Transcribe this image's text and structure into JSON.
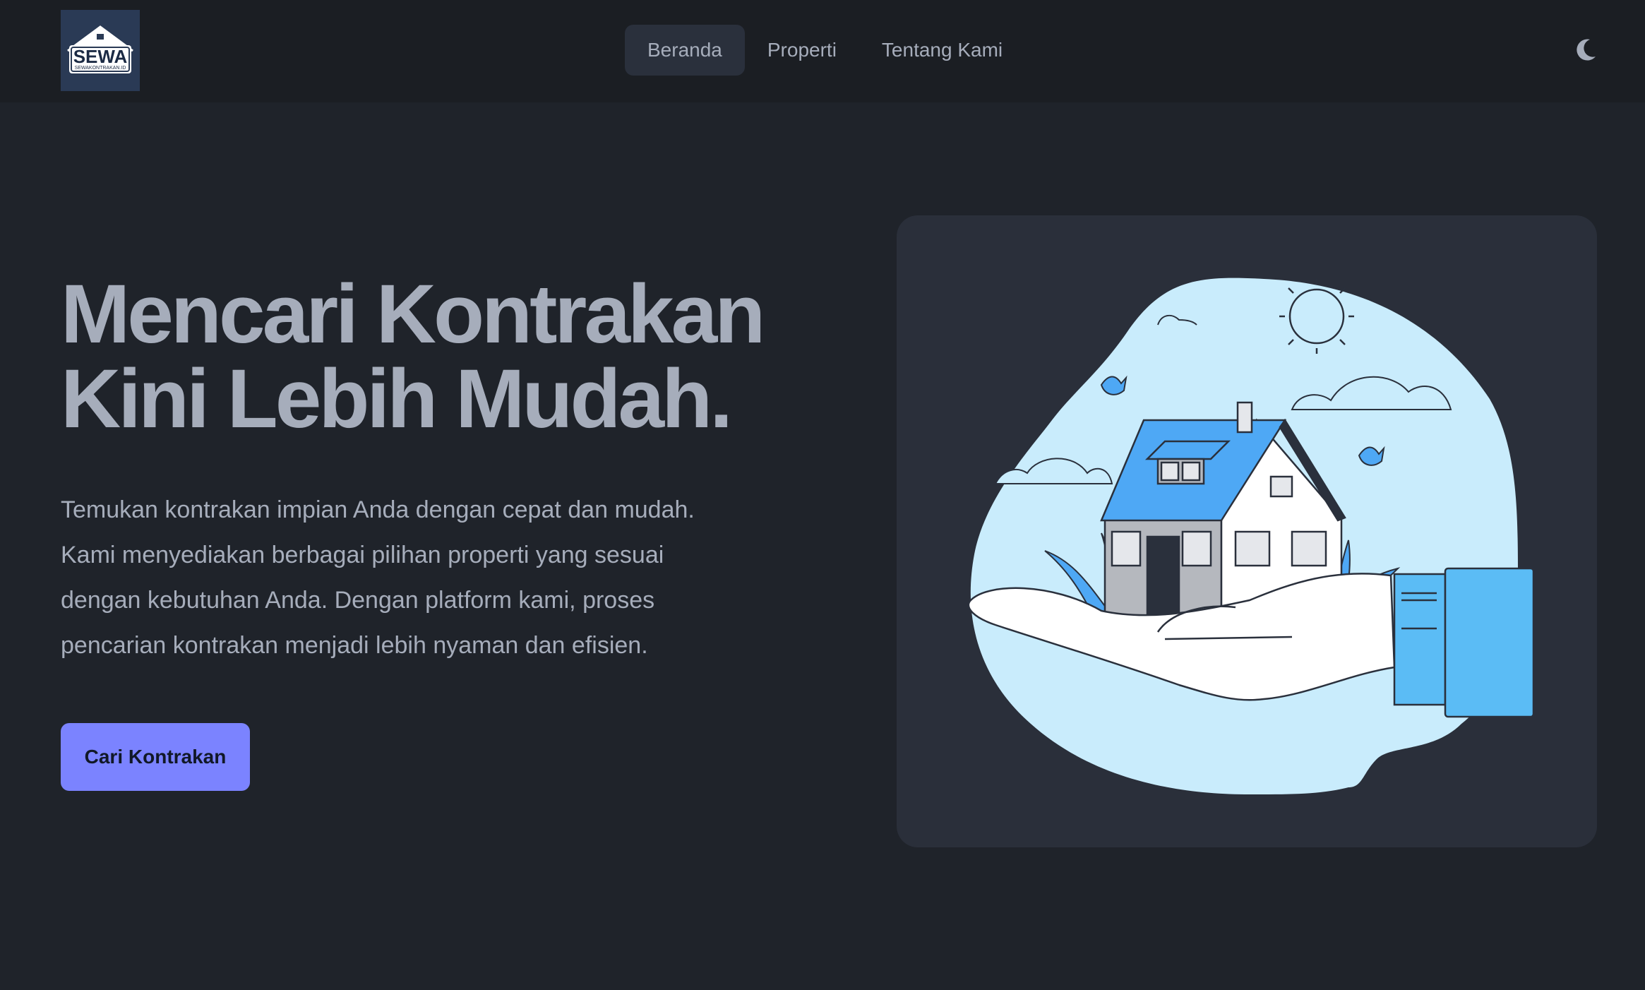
{
  "navbar": {
    "logo": {
      "text": "SEWA",
      "subtext": "SEWAKONTRAKAN.ID"
    },
    "links": [
      {
        "label": "Beranda",
        "active": true
      },
      {
        "label": "Properti",
        "active": false
      },
      {
        "label": "Tentang Kami",
        "active": false
      }
    ],
    "theme_toggle_icon": "moon-icon"
  },
  "hero": {
    "title_lines": [
      "Mencari Kontrakan",
      "Kini Lebih Mudah."
    ],
    "description_lines": [
      "Temukan kontrakan impian Anda dengan cepat dan mudah.",
      "Kami menyediakan berbagai pilihan properti yang sesuai",
      "dengan kebutuhan Anda. Dengan platform kami, proses",
      "pencarian kontrakan menjadi lebih nyaman dan efisien."
    ],
    "cta_label": "Cari Kontrakan",
    "illustration": "house-in-hand-illustration"
  },
  "colors": {
    "background": "#1f232a",
    "navbar": "#1b1e23",
    "primary": "#7b83ff",
    "card": "#2a2f3a",
    "accent_blue": "#4ea8f5",
    "sky": "#c9ecfc"
  }
}
